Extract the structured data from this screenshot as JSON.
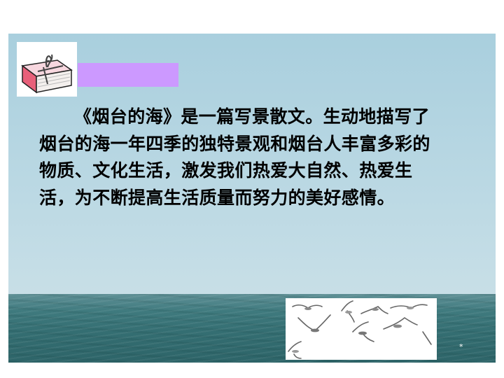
{
  "slide": {
    "paragraph": "《烟台的海》是一篇写景散文。生动地描写了烟台的海一年四季的独特景观和烟台人丰富多彩的物质、文化生活，激发我们热爱大自然、热爱生活，为不断提高生活质量而努力的美好感情。",
    "bottom_mark": "*"
  },
  "colors": {
    "sky": "#b6d6e2",
    "sea": "#346e72",
    "accent_bar": "#cc99ff",
    "book": "#e8607a"
  },
  "icons": [
    "book-icon",
    "seagulls-illustration"
  ]
}
